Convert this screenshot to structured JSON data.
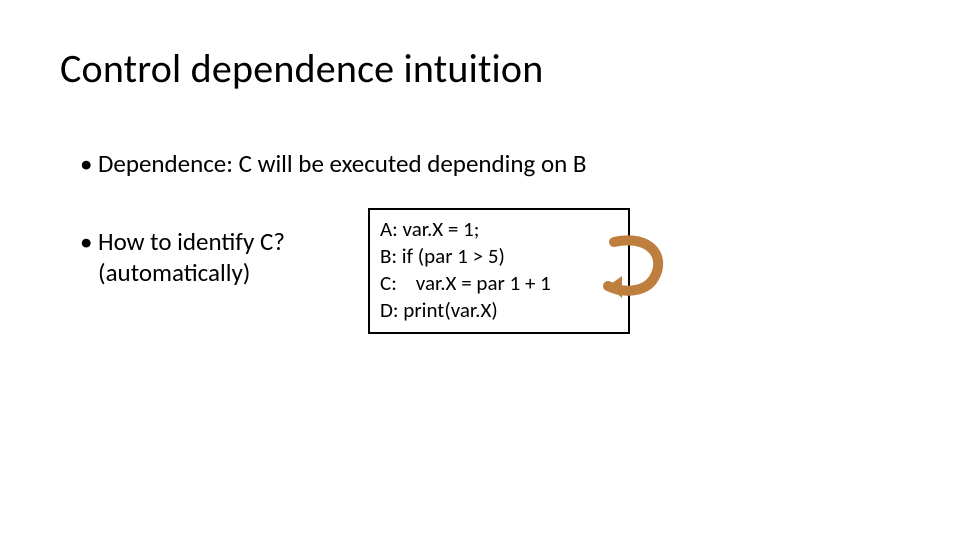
{
  "title": "Control dependence intuition",
  "bullets": {
    "dot": "•",
    "b1": "Dependence: C will be executed depending on B",
    "b2_line1": "How to identify C?",
    "b2_line2": "(automatically)"
  },
  "code": {
    "lineA": "A: var.X = 1;",
    "lineB": "B: if (par 1 > 5)",
    "lineC": "C:    var.X = par 1 + 1",
    "lineD": "D: print(var.X)"
  },
  "colors": {
    "arrow": "#BE7E3E"
  }
}
